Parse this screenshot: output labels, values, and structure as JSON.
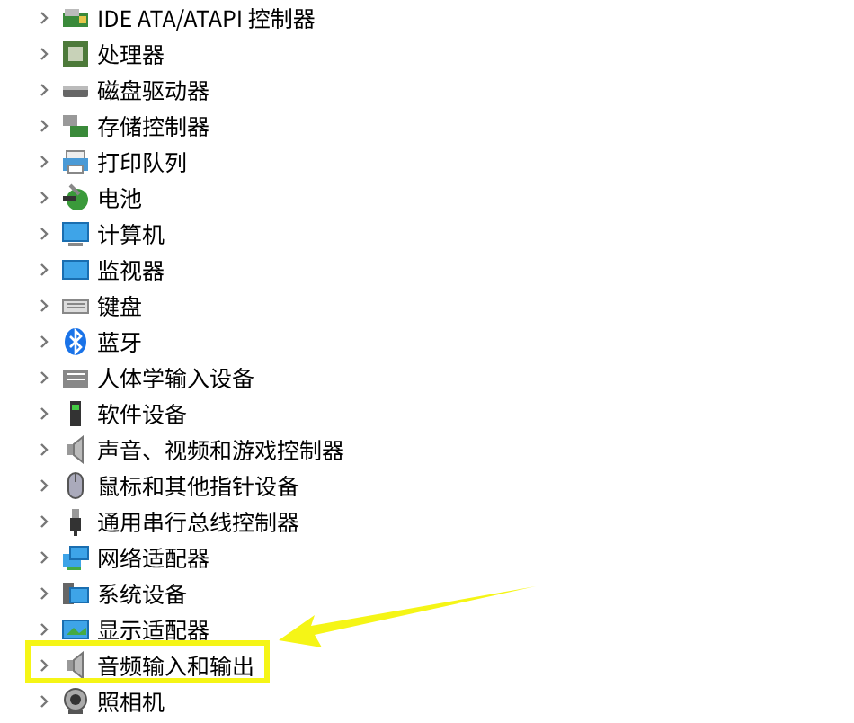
{
  "tree": [
    {
      "label": "IDE ATA/ATAPI 控制器",
      "kind": "chip",
      "expanded": false,
      "highlighted": false
    },
    {
      "label": "处理器",
      "kind": "cpu",
      "expanded": false,
      "highlighted": false
    },
    {
      "label": "磁盘驱动器",
      "kind": "disk",
      "expanded": false,
      "highlighted": false
    },
    {
      "label": "存储控制器",
      "kind": "storage",
      "expanded": false,
      "highlighted": false
    },
    {
      "label": "打印队列",
      "kind": "printer",
      "expanded": false,
      "highlighted": false
    },
    {
      "label": "电池",
      "kind": "battery",
      "expanded": false,
      "highlighted": false
    },
    {
      "label": "计算机",
      "kind": "computer",
      "expanded": false,
      "highlighted": false
    },
    {
      "label": "监视器",
      "kind": "monitor",
      "expanded": false,
      "highlighted": false
    },
    {
      "label": "键盘",
      "kind": "keyboard",
      "expanded": false,
      "highlighted": false
    },
    {
      "label": "蓝牙",
      "kind": "bluetooth",
      "expanded": false,
      "highlighted": false
    },
    {
      "label": "人体学输入设备",
      "kind": "hid",
      "expanded": false,
      "highlighted": false
    },
    {
      "label": "软件设备",
      "kind": "software",
      "expanded": false,
      "highlighted": false
    },
    {
      "label": "声音、视频和游戏控制器",
      "kind": "speaker",
      "expanded": false,
      "highlighted": false
    },
    {
      "label": "鼠标和其他指针设备",
      "kind": "mouse",
      "expanded": false,
      "highlighted": false
    },
    {
      "label": "通用串行总线控制器",
      "kind": "usb",
      "expanded": false,
      "highlighted": false
    },
    {
      "label": "网络适配器",
      "kind": "network",
      "expanded": false,
      "highlighted": false
    },
    {
      "label": "系统设备",
      "kind": "system",
      "expanded": false,
      "highlighted": false
    },
    {
      "label": "显示适配器",
      "kind": "display",
      "expanded": false,
      "highlighted": false
    },
    {
      "label": "音频输入和输出",
      "kind": "speaker",
      "expanded": false,
      "highlighted": true
    },
    {
      "label": "照相机",
      "kind": "camera",
      "expanded": false,
      "highlighted": false
    }
  ]
}
